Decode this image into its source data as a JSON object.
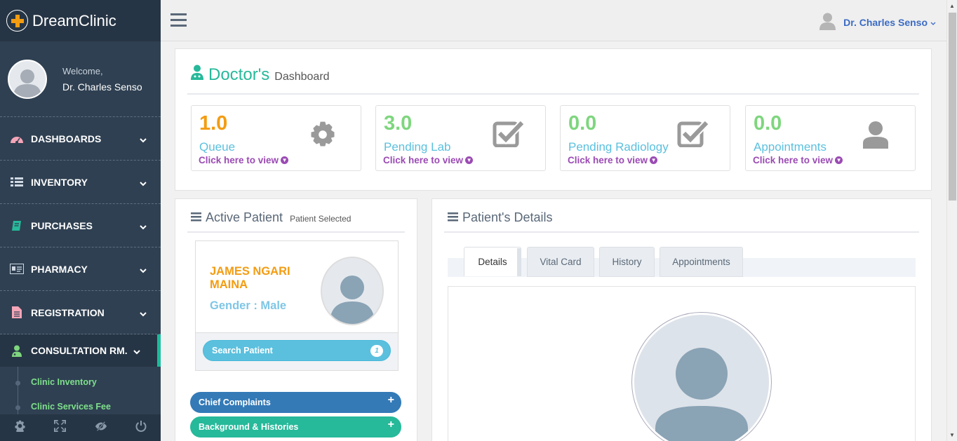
{
  "app": {
    "brand": "DreamClinic"
  },
  "profile": {
    "welcome": "Welcome,",
    "name": "Dr. Charles Senso"
  },
  "sidebar": {
    "items": [
      {
        "label": "DASHBOARDS",
        "icon": "dashboard-icon"
      },
      {
        "label": "INVENTORY",
        "icon": "list-icon"
      },
      {
        "label": "PURCHASES",
        "icon": "book-icon"
      },
      {
        "label": "PHARMACY",
        "icon": "id-card-icon"
      },
      {
        "label": "REGISTRATION",
        "icon": "document-icon"
      },
      {
        "label": "CONSULTATION RM.",
        "icon": "doctor-icon"
      }
    ],
    "subitems": [
      {
        "label": "Clinic Inventory"
      },
      {
        "label": "Clinic Services Fee"
      }
    ],
    "footer_icons": [
      "gear-icon",
      "fullscreen-icon",
      "eye-slash-icon",
      "power-icon"
    ]
  },
  "topbar": {
    "user": "Dr. Charles Senso"
  },
  "dashboard": {
    "title": "Doctor's",
    "subtitle": "Dashboard",
    "stats": [
      {
        "value": "1.0",
        "label": "Queue",
        "link": "Click here to view",
        "color": "#f39c12",
        "label_color": "#5bc0de",
        "icon": "gear-icon"
      },
      {
        "value": "3.0",
        "label": "Pending Lab",
        "link": "Click here to view",
        "color": "#7ed67e",
        "label_color": "#5bc0de",
        "icon": "checkbox-icon"
      },
      {
        "value": "0.0",
        "label": "Pending Radiology",
        "link": "Click here to view",
        "color": "#7ed67e",
        "label_color": "#5bc0de",
        "icon": "checkbox-icon"
      },
      {
        "value": "0.0",
        "label": "Appointments",
        "link": "Click here to view",
        "color": "#7ed67e",
        "label_color": "#5bc0de",
        "icon": "user-icon"
      }
    ]
  },
  "active_patient": {
    "title": "Active Patient",
    "subtitle": "Patient Selected",
    "name": "JAMES NGARI MAINA",
    "gender": "Gender : Male",
    "search_label": "Search Patient",
    "search_badge": "1"
  },
  "accordions": [
    {
      "label": "Chief Complaints",
      "color": "#337ab7"
    },
    {
      "label": "Background & Histories",
      "color": "#26b99a"
    }
  ],
  "patient_details": {
    "title": "Patient's Details",
    "tabs": [
      "Details",
      "Vital Card",
      "History",
      "Appointments"
    ],
    "active_tab": "Details"
  }
}
